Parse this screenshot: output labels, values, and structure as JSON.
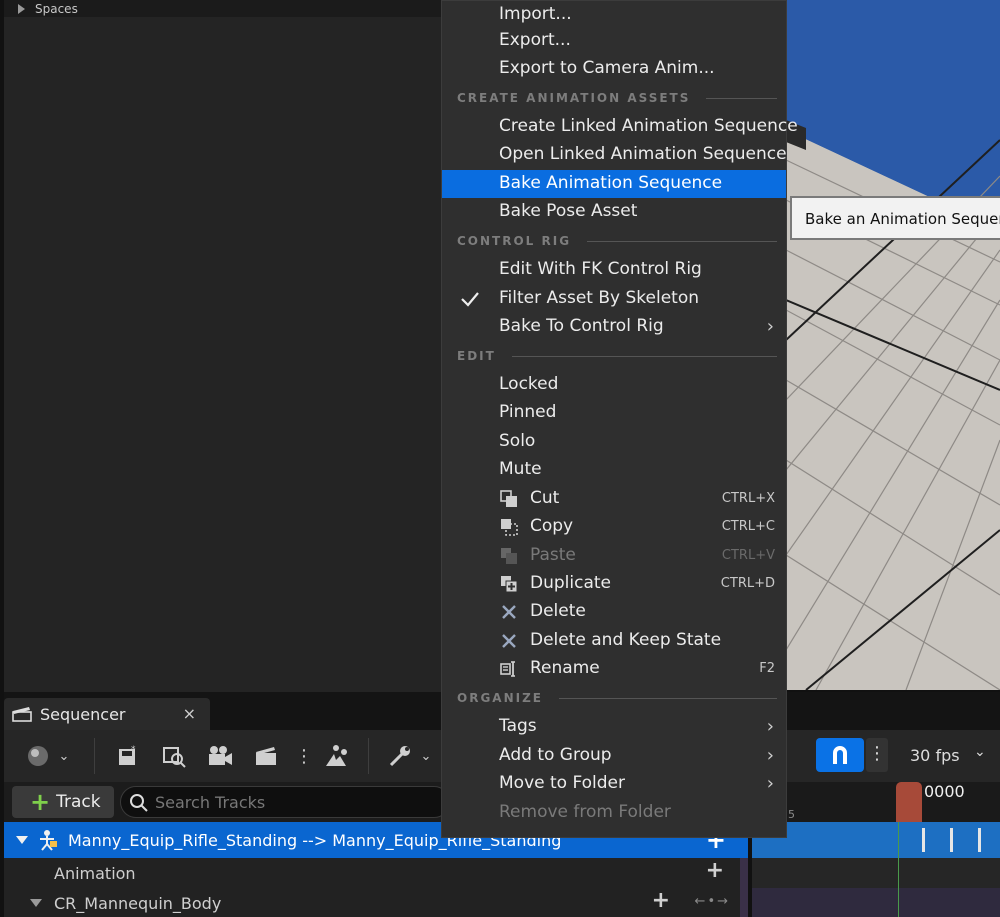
{
  "left_panel": {
    "spaces_label": "Spaces"
  },
  "tooltip": {
    "text": "Bake an Animation Sequence"
  },
  "menu": {
    "items_top": [
      {
        "label": "Import..."
      },
      {
        "label": "Export..."
      },
      {
        "label": "Export to Camera Anim..."
      }
    ],
    "sections": {
      "create": "CREATE ANIMATION ASSETS",
      "control_rig": "CONTROL RIG",
      "edit": "EDIT",
      "organize": "ORGANIZE"
    },
    "create_items": [
      {
        "label": "Create Linked Animation Sequence"
      },
      {
        "label": "Open Linked Animation Sequence"
      },
      {
        "label": "Bake Animation Sequence"
      },
      {
        "label": "Bake Pose Asset"
      }
    ],
    "control_rig_items": [
      {
        "label": "Edit With FK Control Rig"
      },
      {
        "label": "Filter Asset By Skeleton"
      },
      {
        "label": "Bake To Control Rig"
      }
    ],
    "edit_items": [
      {
        "label": "Locked"
      },
      {
        "label": "Pinned"
      },
      {
        "label": "Solo"
      },
      {
        "label": "Mute"
      },
      {
        "label": "Cut",
        "shortcut": "CTRL+X"
      },
      {
        "label": "Copy",
        "shortcut": "CTRL+C"
      },
      {
        "label": "Paste",
        "shortcut": "CTRL+V"
      },
      {
        "label": "Duplicate",
        "shortcut": "CTRL+D"
      },
      {
        "label": "Delete"
      },
      {
        "label": "Delete and Keep State"
      },
      {
        "label": "Rename",
        "shortcut": "F2"
      }
    ],
    "organize_items": [
      {
        "label": "Tags"
      },
      {
        "label": "Add to Group"
      },
      {
        "label": "Move to Folder"
      },
      {
        "label": "Remove from Folder"
      }
    ]
  },
  "sequencer": {
    "tab_label": "Sequencer",
    "close": "×",
    "track_button": "Track",
    "search_placeholder": "Search Tracks",
    "fps": "30 fps",
    "frame": "0000",
    "ruler_tick": "5",
    "tracks": [
      {
        "label": "Manny_Equip_Rifle_Standing --> Manny_Equip_Rifle_Standing"
      },
      {
        "label": "Animation"
      },
      {
        "label": "CR_Mannequin_Body"
      }
    ]
  },
  "colors": {
    "accent": "#0a6de0",
    "panel": "#2f2f2f",
    "background": "#242424"
  }
}
